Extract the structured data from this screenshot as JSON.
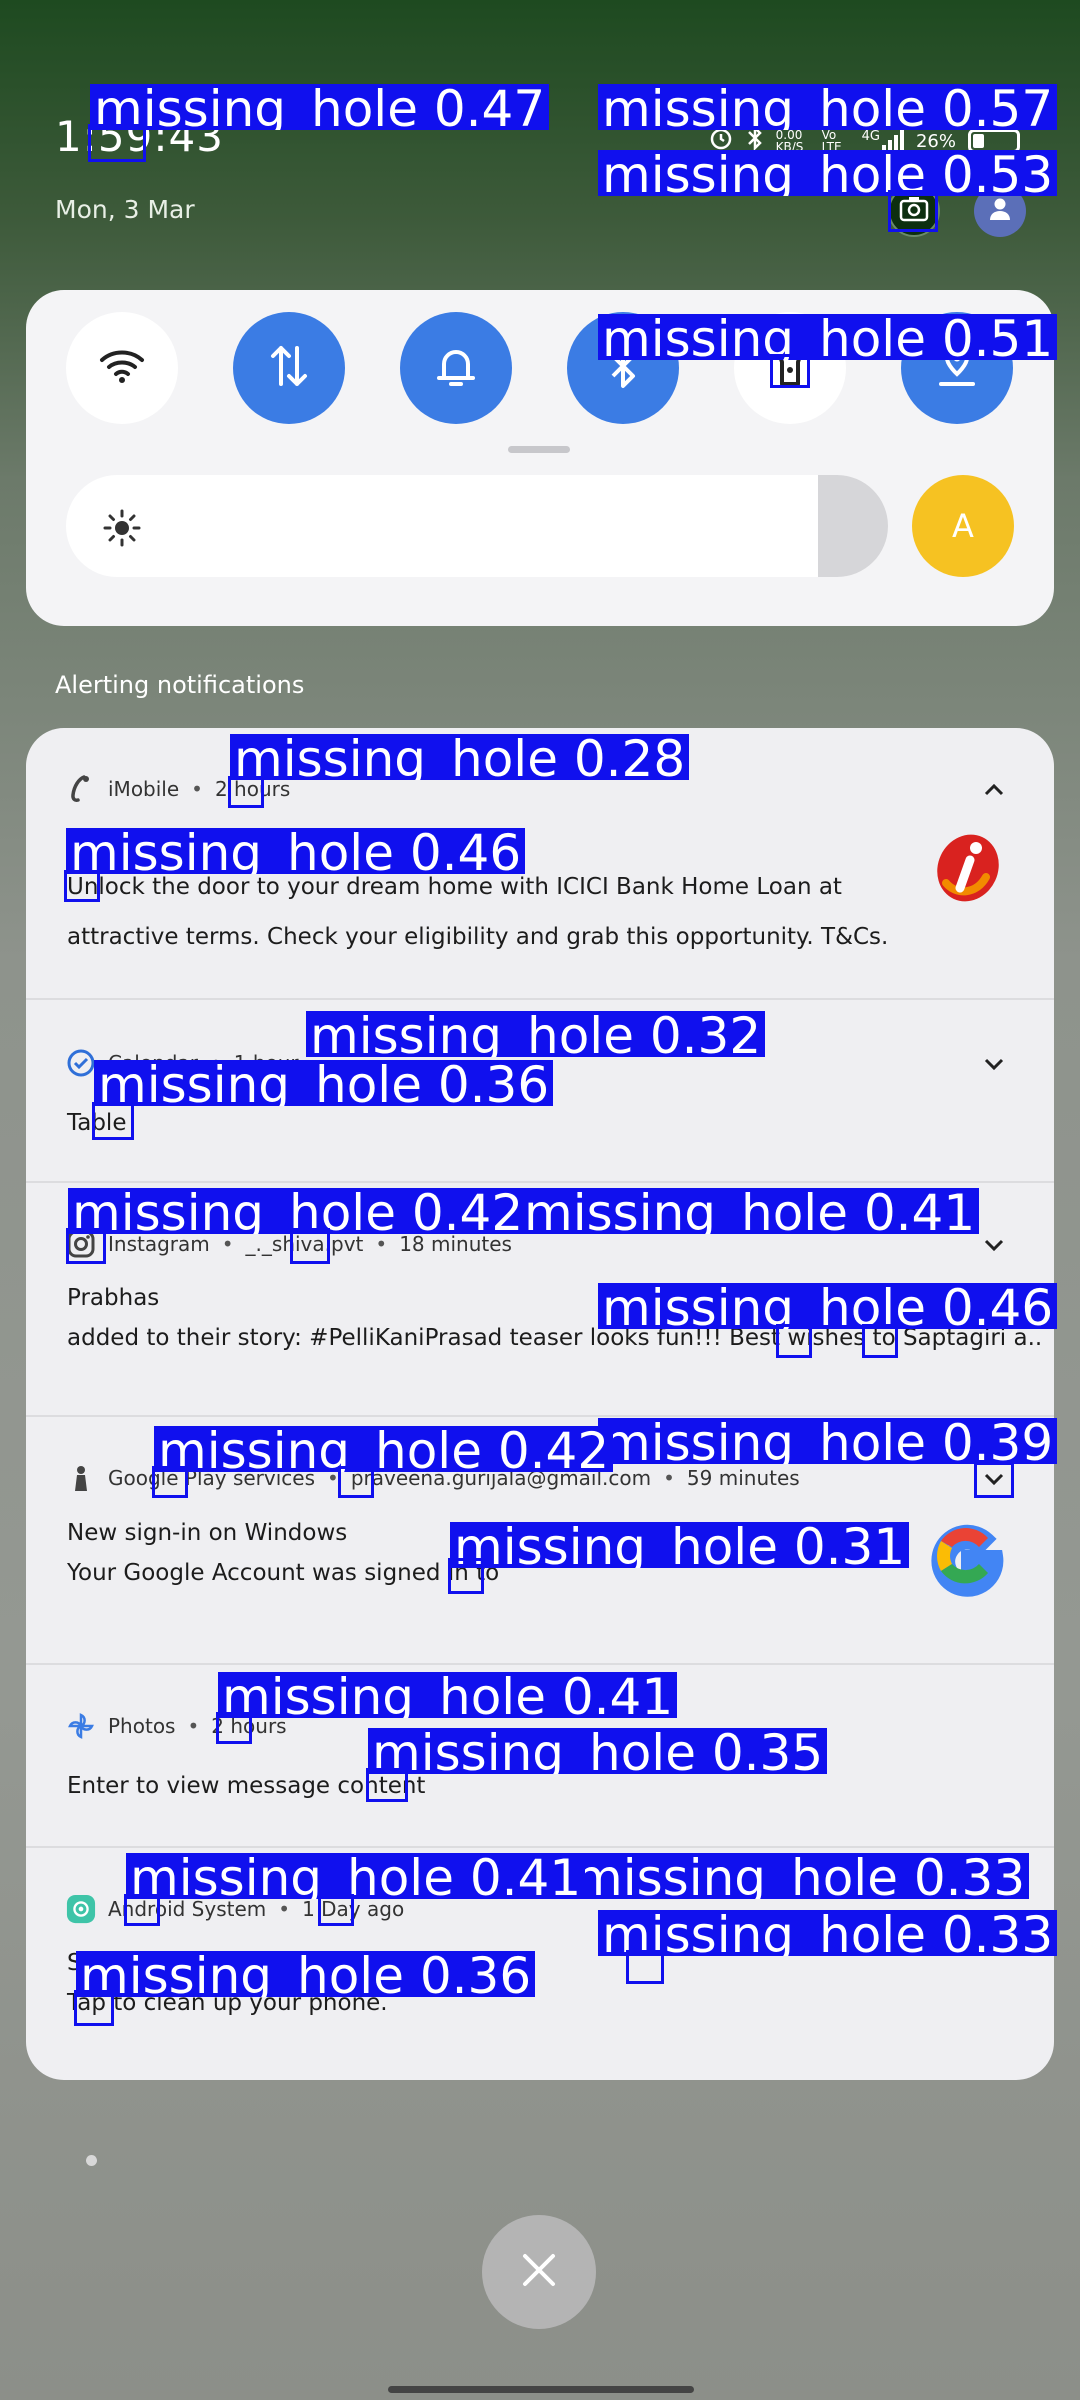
{
  "status_bar": {
    "time": "1:59:43",
    "date": "Mon, 3 Mar",
    "network_speed": "0.00 KB/S",
    "volte": "Vo LTE",
    "signal": "4G",
    "battery": "26%",
    "battery_level": 0.26
  },
  "quick_settings": {
    "tiles": [
      {
        "name": "wifi",
        "state": "off",
        "icon": "wifi-icon"
      },
      {
        "name": "mobile-data",
        "state": "on",
        "icon": "data-arrows-icon"
      },
      {
        "name": "sound",
        "state": "on",
        "icon": "bell-icon"
      },
      {
        "name": "bluetooth",
        "state": "on",
        "icon": "bluetooth-icon"
      },
      {
        "name": "torch",
        "state": "off",
        "icon": "torch-icon"
      },
      {
        "name": "location",
        "state": "on",
        "icon": "location-icon"
      }
    ],
    "brightness_auto_label": "A",
    "accent_color": "#3b7ce4",
    "auto_color": "#f6c222"
  },
  "section_label": "Alerting notifications",
  "notifications": [
    {
      "app": "iMobile",
      "time": "2 hours",
      "lines": [
        "Unlock the door to your dream home with ICICI Bank Home Loan at",
        "attractive terms. Check your eligibility and grab this opportunity. T&Cs."
      ],
      "expanded": true
    },
    {
      "app": "Calendar",
      "time": "1 hour",
      "lines": [
        "Table"
      ],
      "expanded": false
    },
    {
      "app": "Instagram",
      "account": "_._shiva.pvt",
      "time": "18 minutes",
      "lines": [
        "Prabhas",
        "added to their story: #PelliKaniPrasad teaser looks fun!!!  Best wishes to Saptagiri a.."
      ],
      "expanded": false
    },
    {
      "app": "Google Play services",
      "account": "praveena.gurijala@gmail.com",
      "time": "59 minutes",
      "lines": [
        "New sign-in on Windows",
        "Your Google Account was signed in to"
      ],
      "expanded": false
    },
    {
      "app": "Photos",
      "time": "2 hours",
      "lines": [
        "Enter to view message content"
      ],
      "expanded": false
    },
    {
      "app": "Android System",
      "time": "1 Day ago",
      "lines": [
        "Storage space is declining.",
        "Tap to clean up your phone."
      ],
      "expanded": false
    }
  ],
  "detections": [
    {
      "label": "missing_hole 0.47"
    },
    {
      "label": "missing_hole 0.57"
    },
    {
      "label": "missing_hole 0.53"
    },
    {
      "label": "missing_hole 0.51"
    },
    {
      "label": "missing_hole 0.28"
    },
    {
      "label": "missing_hole 0.46"
    },
    {
      "label": "missing_hole 0.32"
    },
    {
      "label": "missing_hole 0.36"
    },
    {
      "label": "missing_hole 0.42"
    },
    {
      "label": "missing_hole 0.41"
    },
    {
      "label": "missing_hole 0.46"
    },
    {
      "label": "missing_hole 0.42"
    },
    {
      "label": "missing_hole 0.39"
    },
    {
      "label": "missing_hole 0.31"
    },
    {
      "label": "missing_hole 0.41"
    },
    {
      "label": "missing_hole 0.35"
    },
    {
      "label": "missing_hole 0.41"
    },
    {
      "label": "missing_hole 0.33"
    },
    {
      "label": "missing_hole 0.33"
    },
    {
      "label": "missing_hole 0.36"
    }
  ],
  "detection_color": "#1010ee"
}
